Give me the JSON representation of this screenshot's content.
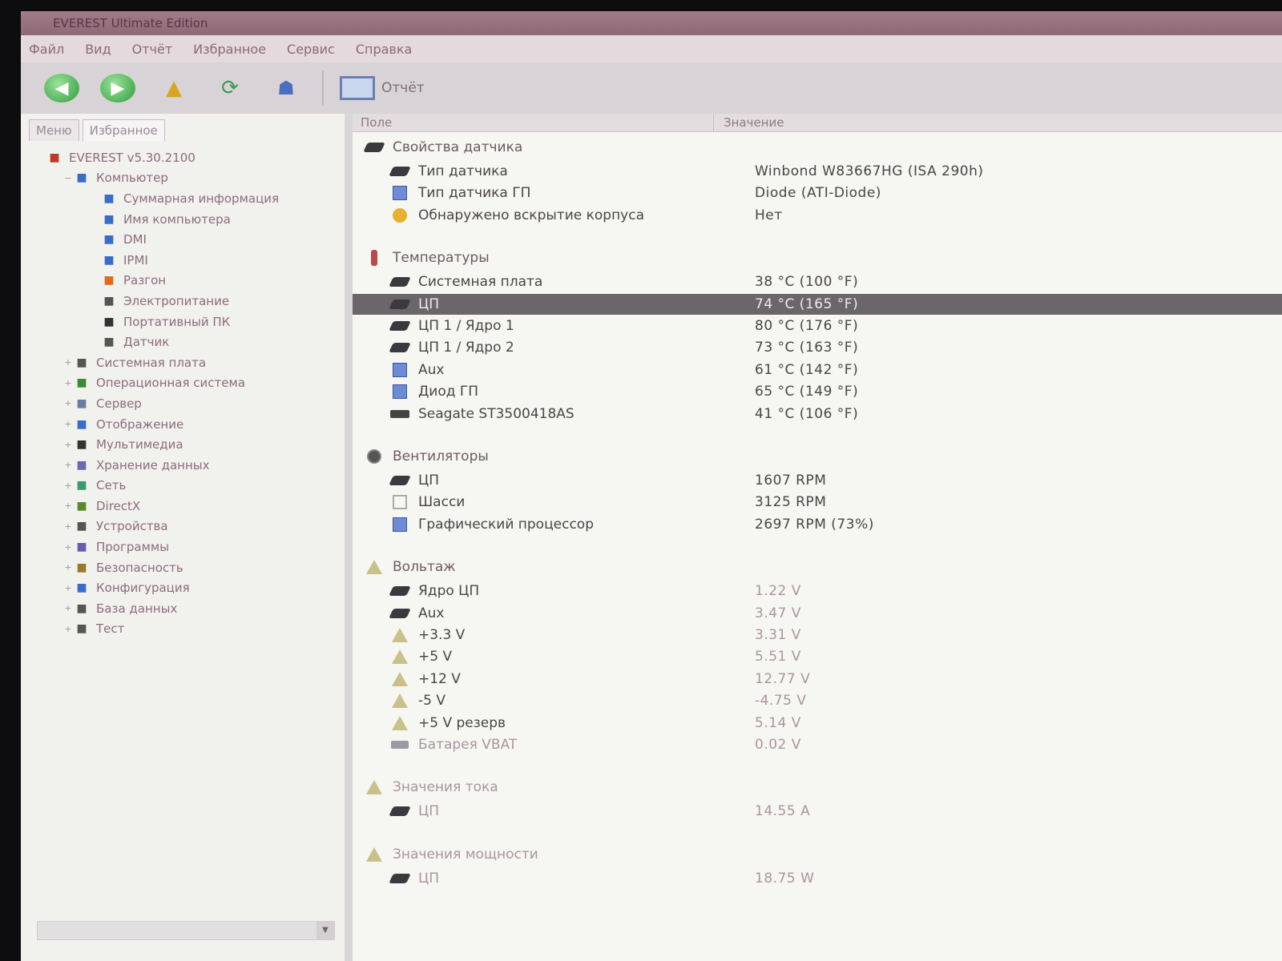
{
  "window": {
    "title": "EVEREST Ultimate Edition"
  },
  "menu": [
    "Файл",
    "Вид",
    "Отчёт",
    "Избранное",
    "Сервис",
    "Справка"
  ],
  "toolbar": {
    "report_label": "Отчёт"
  },
  "left_tabs": [
    "Меню",
    "Избранное"
  ],
  "tree": [
    {
      "label": "EVEREST v5.30.2100",
      "level": 0,
      "exp": "",
      "icon": "everest-icon"
    },
    {
      "label": "Компьютер",
      "level": 1,
      "exp": "−",
      "icon": "computer-icon"
    },
    {
      "label": "Суммарная информация",
      "level": 2,
      "exp": "",
      "icon": "summary-icon"
    },
    {
      "label": "Имя компьютера",
      "level": 2,
      "exp": "",
      "icon": "computer-name-icon"
    },
    {
      "label": "DMI",
      "level": 2,
      "exp": "",
      "icon": "dmi-icon"
    },
    {
      "label": "IPMI",
      "level": 2,
      "exp": "",
      "icon": "ipmi-icon"
    },
    {
      "label": "Разгон",
      "level": 2,
      "exp": "",
      "icon": "overclock-icon"
    },
    {
      "label": "Электропитание",
      "level": 2,
      "exp": "",
      "icon": "power-icon"
    },
    {
      "label": "Портативный ПК",
      "level": 2,
      "exp": "",
      "icon": "laptop-icon"
    },
    {
      "label": "Датчик",
      "level": 2,
      "exp": "",
      "icon": "sensor-icon"
    },
    {
      "label": "Системная плата",
      "level": 1,
      "exp": "+",
      "icon": "motherboard-icon"
    },
    {
      "label": "Операционная система",
      "level": 1,
      "exp": "+",
      "icon": "os-icon"
    },
    {
      "label": "Сервер",
      "level": 1,
      "exp": "+",
      "icon": "server-icon"
    },
    {
      "label": "Отображение",
      "level": 1,
      "exp": "+",
      "icon": "display-icon"
    },
    {
      "label": "Мультимедиа",
      "level": 1,
      "exp": "+",
      "icon": "multimedia-icon"
    },
    {
      "label": "Хранение данных",
      "level": 1,
      "exp": "+",
      "icon": "storage-icon"
    },
    {
      "label": "Сеть",
      "level": 1,
      "exp": "+",
      "icon": "network-icon"
    },
    {
      "label": "DirectX",
      "level": 1,
      "exp": "+",
      "icon": "directx-icon"
    },
    {
      "label": "Устройства",
      "level": 1,
      "exp": "+",
      "icon": "devices-icon"
    },
    {
      "label": "Программы",
      "level": 1,
      "exp": "+",
      "icon": "programs-icon"
    },
    {
      "label": "Безопасность",
      "level": 1,
      "exp": "+",
      "icon": "security-icon"
    },
    {
      "label": "Конфигурация",
      "level": 1,
      "exp": "+",
      "icon": "config-icon"
    },
    {
      "label": "База данных",
      "level": 1,
      "exp": "+",
      "icon": "database-icon"
    },
    {
      "label": "Тест",
      "level": 1,
      "exp": "+",
      "icon": "test-icon"
    }
  ],
  "columns": {
    "field": "Поле",
    "value": "Значение"
  },
  "rows": [
    {
      "kind": "section",
      "label": "Свойства датчика",
      "value": "",
      "icon": "chip"
    },
    {
      "kind": "item",
      "label": "Тип датчика",
      "value": "Winbond W83667HG (ISA 290h)",
      "icon": "chip"
    },
    {
      "kind": "item",
      "label": "Тип датчика ГП",
      "value": "Diode (ATI-Diode)",
      "icon": "mon"
    },
    {
      "kind": "item",
      "label": "Обнаружено вскрытие корпуса",
      "value": "Нет",
      "icon": "warn"
    },
    {
      "kind": "gap"
    },
    {
      "kind": "section",
      "label": "Температуры",
      "value": "",
      "icon": "therm"
    },
    {
      "kind": "item",
      "label": "Системная плата",
      "value": "38 °C (100 °F)",
      "icon": "chip"
    },
    {
      "kind": "item",
      "label": "ЦП",
      "value": "74 °C (165 °F)",
      "icon": "chip",
      "selected": true
    },
    {
      "kind": "item",
      "label": "ЦП 1 / Ядро 1",
      "value": "80 °C (176 °F)",
      "icon": "chip"
    },
    {
      "kind": "item",
      "label": "ЦП 1 / Ядро 2",
      "value": "73 °C (163 °F)",
      "icon": "chip"
    },
    {
      "kind": "item",
      "label": "Aux",
      "value": "61 °C (142 °F)",
      "icon": "mon"
    },
    {
      "kind": "item",
      "label": "Диод ГП",
      "value": "65 °C (149 °F)",
      "icon": "mon"
    },
    {
      "kind": "item",
      "label": "Seagate ST3500418AS",
      "value": "41 °C (106 °F)",
      "icon": "disk"
    },
    {
      "kind": "gap"
    },
    {
      "kind": "section",
      "label": "Вентиляторы",
      "value": "",
      "icon": "fan"
    },
    {
      "kind": "item",
      "label": "ЦП",
      "value": "1607 RPM",
      "icon": "chip"
    },
    {
      "kind": "item",
      "label": "Шасси",
      "value": "3125 RPM",
      "icon": "case"
    },
    {
      "kind": "item",
      "label": "Графический процессор",
      "value": "2697 RPM (73%)",
      "icon": "mon"
    },
    {
      "kind": "gap"
    },
    {
      "kind": "section",
      "label": "Вольтаж",
      "value": "",
      "icon": "tri"
    },
    {
      "kind": "item",
      "label": "Ядро ЦП",
      "value": "1.22 V",
      "icon": "chip"
    },
    {
      "kind": "item",
      "label": "Aux",
      "value": "3.47 V",
      "icon": "chip"
    },
    {
      "kind": "item",
      "label": "+3.3 V",
      "value": "3.31 V",
      "icon": "tri"
    },
    {
      "kind": "item",
      "label": "+5 V",
      "value": "5.51 V",
      "icon": "tri"
    },
    {
      "kind": "item",
      "label": "+12 V",
      "value": "12.77 V",
      "icon": "tri"
    },
    {
      "kind": "item",
      "label": "-5 V",
      "value": "-4.75 V",
      "icon": "tri"
    },
    {
      "kind": "item",
      "label": "+5 V резерв",
      "value": "5.14 V",
      "icon": "tri"
    },
    {
      "kind": "item",
      "label": "Батарея VBAT",
      "value": "0.02 V",
      "icon": "bat"
    },
    {
      "kind": "gap"
    },
    {
      "kind": "section",
      "label": "Значения тока",
      "value": "",
      "icon": "tri"
    },
    {
      "kind": "item",
      "label": "ЦП",
      "value": "14.55 A",
      "icon": "chip"
    },
    {
      "kind": "gap"
    },
    {
      "kind": "section",
      "label": "Значения мощности",
      "value": "",
      "icon": "tri"
    },
    {
      "kind": "item",
      "label": "ЦП",
      "value": "18.75 W",
      "icon": "chip"
    }
  ]
}
